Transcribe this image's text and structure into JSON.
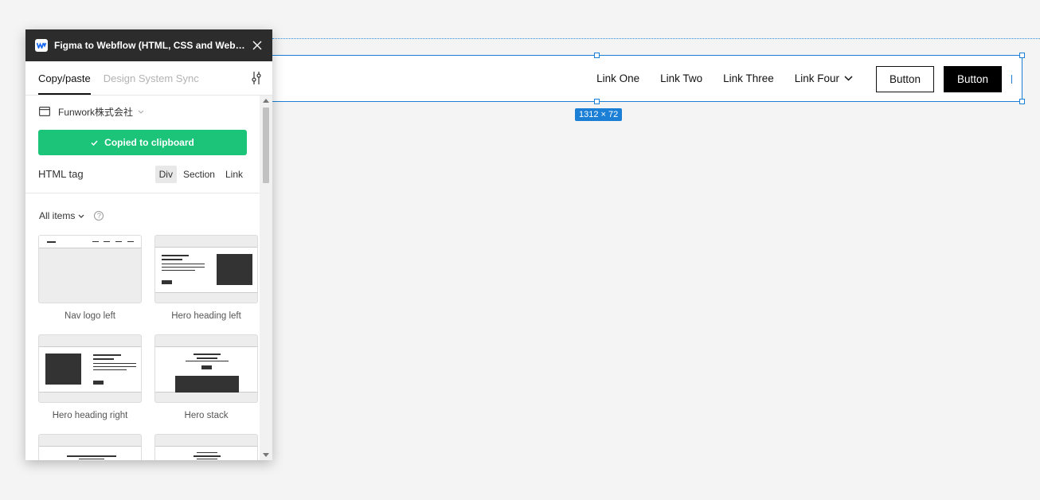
{
  "panel": {
    "title": "Figma to Webflow (HTML, CSS and Websit...",
    "tabs": [
      {
        "label": "Copy/paste",
        "active": true
      },
      {
        "label": "Design System Sync",
        "active": false
      }
    ],
    "site_name": "Funwork株式会社",
    "copied_label": "Copied to clipboard",
    "html_tag_label": "HTML tag",
    "html_tag_options": [
      "Div",
      "Section",
      "Link"
    ],
    "html_tag_selected": "Div",
    "filter_label": "All items",
    "help_glyph": "?",
    "items": [
      {
        "label": "Nav logo left"
      },
      {
        "label": "Hero heading left"
      },
      {
        "label": "Hero heading right"
      },
      {
        "label": "Hero stack"
      }
    ]
  },
  "canvas": {
    "nav_links": [
      "Link One",
      "Link Two",
      "Link Three",
      "Link Four"
    ],
    "button_outline_label": "Button",
    "button_solid_label": "Button",
    "size_badge": "1312 × 72"
  },
  "colors": {
    "accent_blue": "#1b7fd6",
    "success_green": "#1cc47a",
    "header_dark": "#2c2c2c"
  }
}
